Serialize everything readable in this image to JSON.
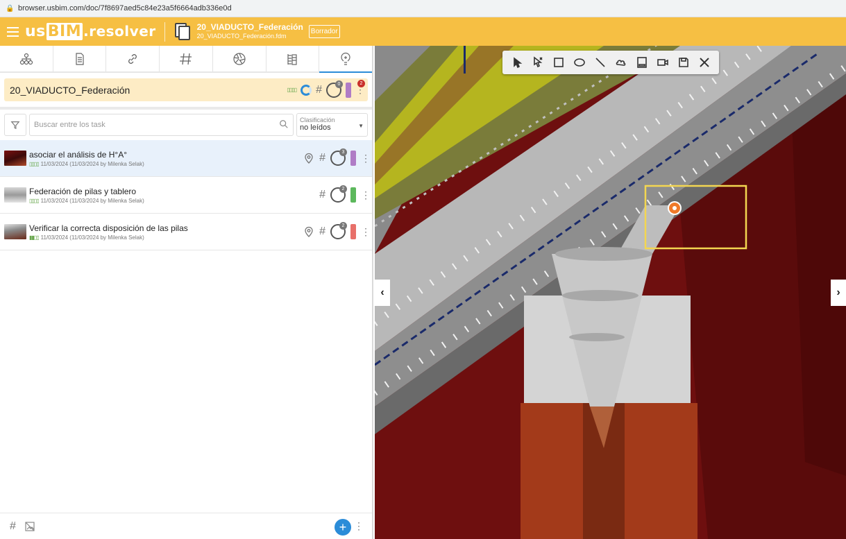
{
  "browser": {
    "url": "browser.usbim.com/doc/7f8697aed5c84e23a5f6664adb336e0d"
  },
  "appbar": {
    "logo_us": "us",
    "logo_bim": "BIM",
    "logo_resolver": ".resolver",
    "doc_title": "20_VIADUCTO_Federación",
    "doc_file": "20_VIADUCTO_Federación.fdm",
    "draft_label": "Borrador",
    "accent_color": "#f6bf43"
  },
  "tabs": [
    {
      "icon": "hierarchy-icon"
    },
    {
      "icon": "document-icon"
    },
    {
      "icon": "link-icon"
    },
    {
      "icon": "hash-icon"
    },
    {
      "icon": "aperture-icon"
    },
    {
      "icon": "structure-icon"
    },
    {
      "icon": "issues-icon",
      "active": true
    }
  ],
  "project": {
    "name": "20_VIADUCTO_Federación",
    "hash": "#",
    "user_count": "0",
    "alert_count": "2",
    "color": "#b07cc6"
  },
  "search": {
    "placeholder": "Buscar entre los task",
    "sort_label": "Clasificación",
    "sort_value": "no leídos"
  },
  "tasks": [
    {
      "title": "asociar el análisis de H°A°",
      "meta": "11/03/2024 (11/03/2024 by Milenka Selak)",
      "hash": "#",
      "user_count": "3",
      "color": "#b07cc6"
    },
    {
      "title": "Federación de pilas y tablero",
      "meta": "11/03/2024 (11/03/2024 by Milenka Selak)",
      "hash": "#",
      "user_count": "2",
      "color": "#5cb85c"
    },
    {
      "title": "Verificar la correcta disposición de las pilas",
      "meta": "11/03/2024 (11/03/2024 by Milenka Selak)",
      "hash": "#",
      "user_count": "2",
      "color": "#e8706a"
    }
  ],
  "footer": {
    "hash": "#",
    "add": "+"
  },
  "viewport": {
    "tools": [
      "select-icon",
      "pick-icon",
      "rectangle-icon",
      "ellipse-icon",
      "line-icon",
      "cloud-icon",
      "note-icon",
      "camera-icon",
      "save-icon",
      "close-icon"
    ]
  }
}
